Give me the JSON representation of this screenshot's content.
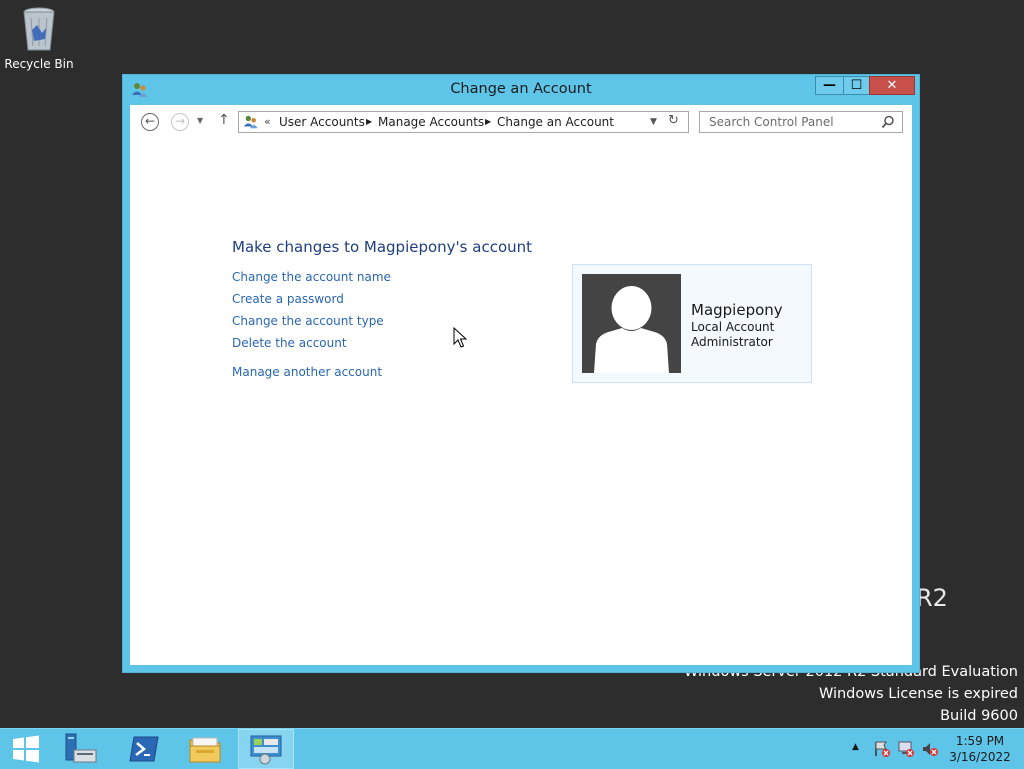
{
  "desktop": {
    "recycle_bin_label": "Recycle Bin",
    "watermark": {
      "r2": "R2",
      "edition": "Windows Server 2012 R2 Standard Evaluation",
      "license": "Windows License is expired",
      "build": "Build 9600"
    }
  },
  "window": {
    "title": "Change an Account",
    "controls": {
      "minimize": "—",
      "maximize": "☐",
      "close": "✕"
    }
  },
  "address_bar": {
    "overflow": "«",
    "breadcrumbs": [
      "User Accounts",
      "Manage Accounts",
      "Change an Account"
    ]
  },
  "search": {
    "placeholder": "Search Control Panel"
  },
  "content": {
    "heading": "Make changes to Magpiepony's account",
    "links": [
      "Change the account name",
      "Create a password",
      "Change the account type",
      "Delete the account"
    ],
    "manage_link": "Manage another account"
  },
  "account": {
    "name": "Magpiepony",
    "type": "Local Account",
    "role": "Administrator"
  },
  "taskbar": {
    "items": [
      "start-button",
      "server-manager-icon",
      "powershell-icon",
      "file-explorer-icon",
      "control-panel-icon"
    ],
    "active_item": "control-panel-icon",
    "clock": {
      "time": "1:59 PM",
      "date": "3/16/2022"
    }
  },
  "colors": {
    "window_frame": "#5ec4e8",
    "link": "#2a66b0",
    "heading": "#1e3f80",
    "close_button": "#c7504a",
    "desktop": "#2d2d2d"
  }
}
